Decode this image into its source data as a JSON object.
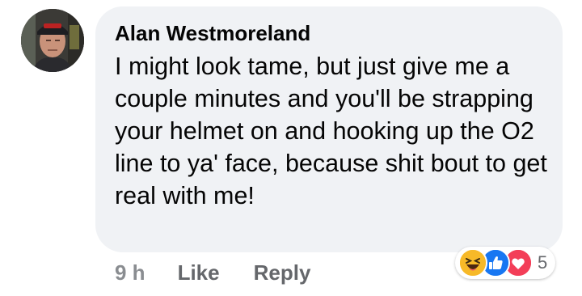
{
  "comment": {
    "author": "Alan Westmoreland",
    "text": "I might look tame, but just give me a couple minutes and you'll be strapping your helmet on and hooking up the O2 line to ya' face, because shit bout to get real with me!",
    "time": "9 h",
    "like_label": "Like",
    "reply_label": "Reply",
    "reactions": {
      "icons": [
        "haha-icon",
        "like-icon",
        "love-icon"
      ],
      "count": "5"
    }
  },
  "colors": {
    "bubble": "#f0f2f5",
    "secondary_text": "#65676b",
    "like_blue": "#1877f2",
    "love_red": "#f33e58",
    "haha_yellow": "#f7b928"
  }
}
